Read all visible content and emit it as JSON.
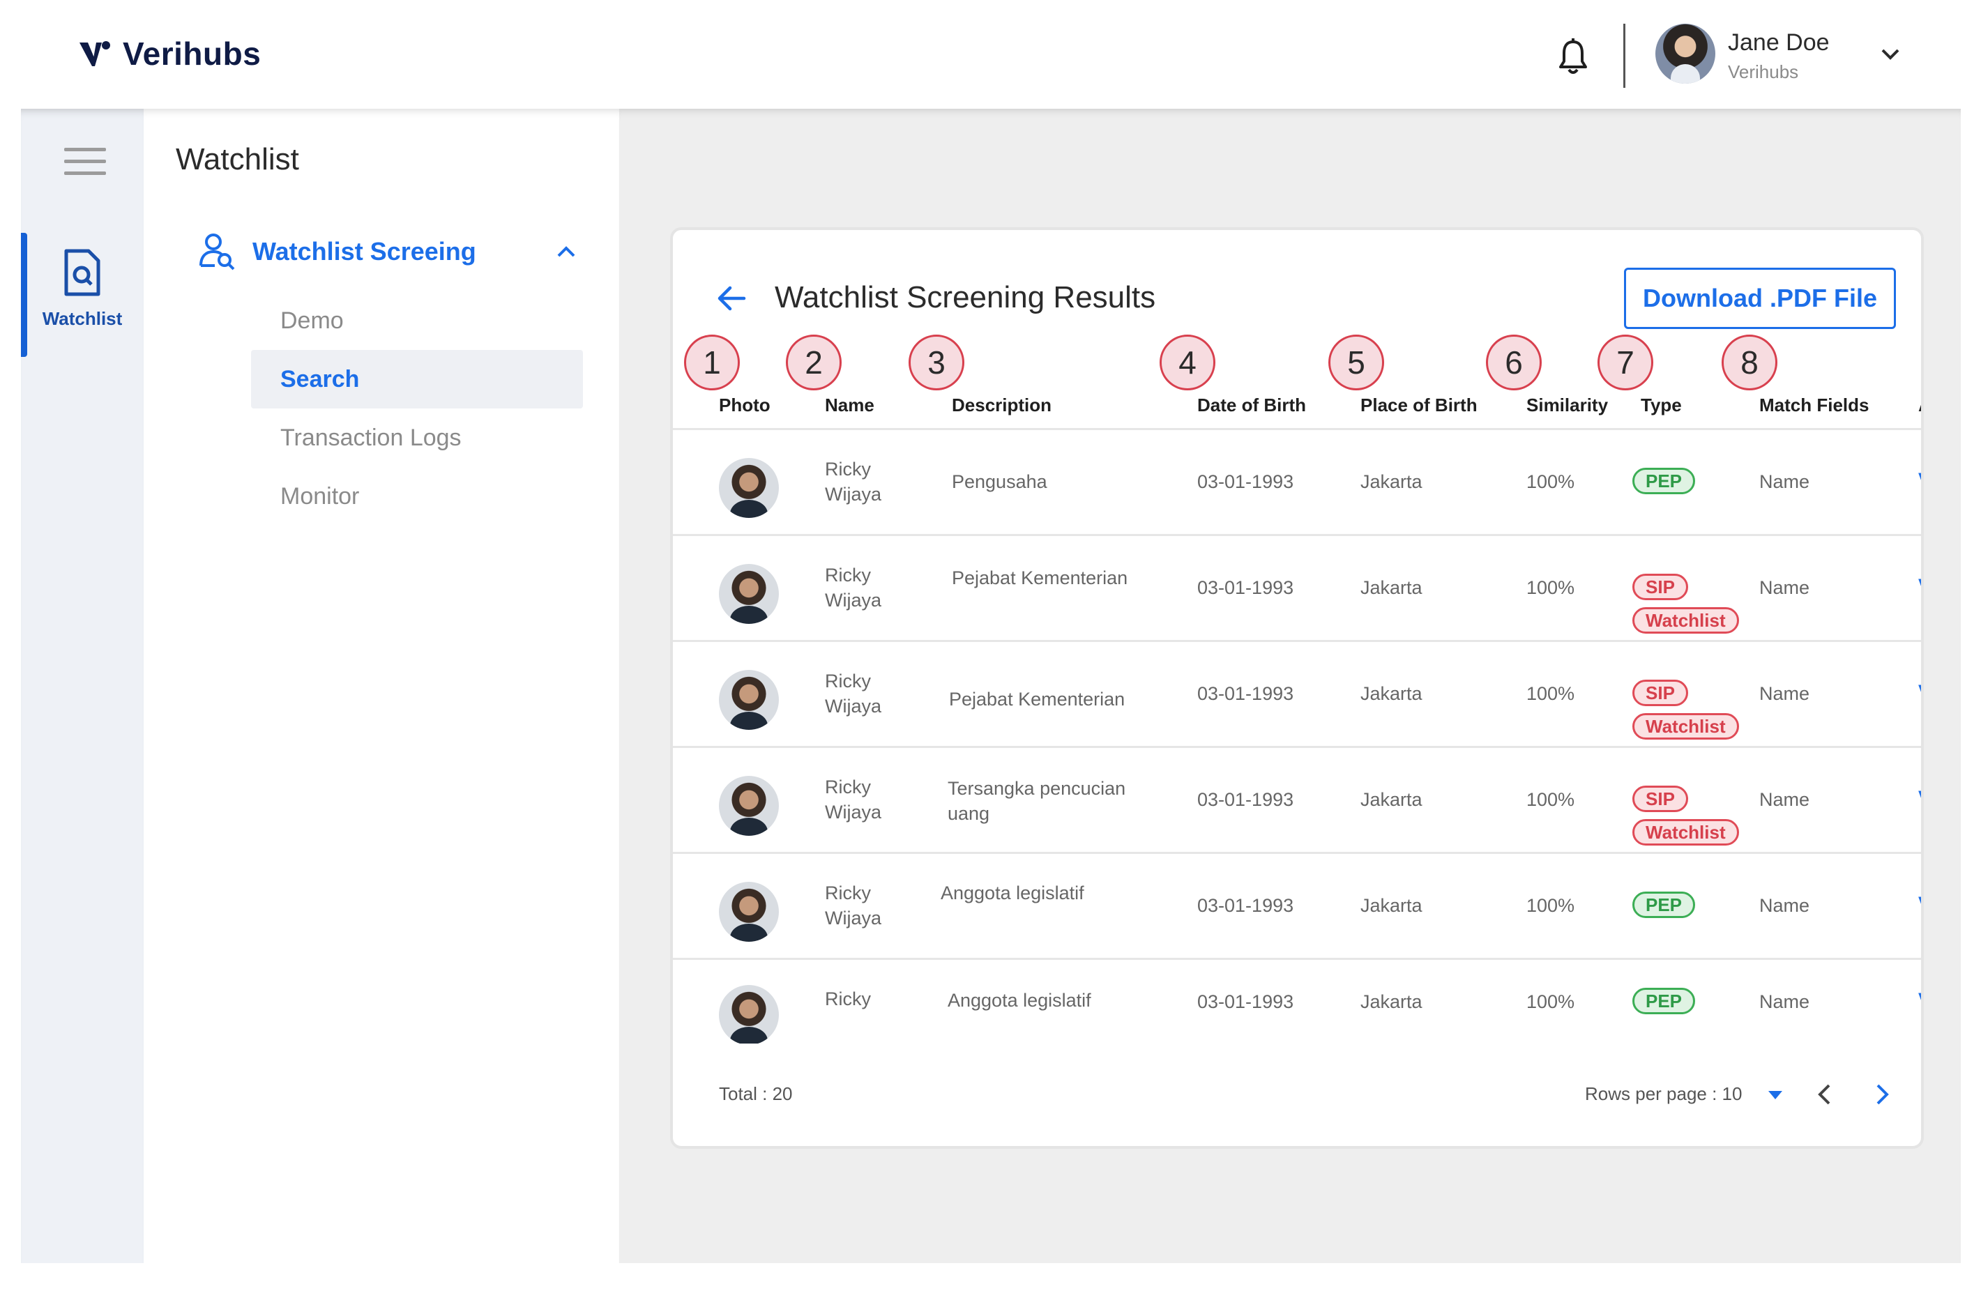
{
  "header": {
    "brand": "Verihubs",
    "user_name": "Jane Doe",
    "user_org": "Verihubs"
  },
  "rail": {
    "active_label": "Watchlist"
  },
  "sidebar": {
    "title": "Watchlist",
    "group_label": "Watchlist Screeing",
    "items": [
      {
        "label": "Demo"
      },
      {
        "label": "Search"
      },
      {
        "label": "Transaction Logs"
      },
      {
        "label": "Monitor"
      }
    ],
    "active_index": 1
  },
  "results": {
    "title": "Watchlist Screening Results",
    "download_label": "Download .PDF File",
    "markers": [
      "1",
      "2",
      "3",
      "4",
      "5",
      "6",
      "7",
      "8"
    ],
    "columns": [
      "Photo",
      "Name",
      "Description",
      "Date of Birth",
      "Place of Birth",
      "Similarity",
      "Type",
      "Match Fields",
      "Ac"
    ],
    "rows": [
      {
        "name_first": "Ricky",
        "name_last": "Wijaya",
        "description": "Pengusaha",
        "description_2": "",
        "dob": "03-01-1993",
        "pob": "Jakarta",
        "similarity": "100%",
        "types": [
          "PEP"
        ],
        "match_fields": "Name",
        "action": "Vi"
      },
      {
        "name_first": "Ricky",
        "name_last": "Wijaya",
        "description": "Pejabat Kementerian",
        "description_2": "",
        "dob": "03-01-1993",
        "pob": "Jakarta",
        "similarity": "100%",
        "types": [
          "SIP",
          "Watchlist"
        ],
        "match_fields": "Name",
        "action": "Vi"
      },
      {
        "name_first": "Ricky",
        "name_last": "Wijaya",
        "description": "Pejabat Kementerian",
        "description_2": "",
        "dob": "03-01-1993",
        "pob": "Jakarta",
        "similarity": "100%",
        "types": [
          "SIP",
          "Watchlist"
        ],
        "match_fields": "Name",
        "action": "Vi"
      },
      {
        "name_first": "Ricky",
        "name_last": "Wijaya",
        "description": "Tersangka pencucian",
        "description_2": "uang",
        "dob": "03-01-1993",
        "pob": "Jakarta",
        "similarity": "100%",
        "types": [
          "SIP",
          "Watchlist"
        ],
        "match_fields": "Name",
        "action": "Vi"
      },
      {
        "name_first": "Ricky",
        "name_last": "Wijaya",
        "description": "Anggota legislatif",
        "description_2": "",
        "dob": "03-01-1993",
        "pob": "Jakarta",
        "similarity": "100%",
        "types": [
          "PEP"
        ],
        "match_fields": "Name",
        "action": "Vi"
      },
      {
        "name_first": "Ricky",
        "name_last": "",
        "description": "Anggota legislatif",
        "description_2": "",
        "dob": "03-01-1993",
        "pob": "Jakarta",
        "similarity": "100%",
        "types": [
          "PEP"
        ],
        "match_fields": "Name",
        "action": "Vi"
      }
    ],
    "total_label": "Total : 20",
    "rows_per_page_label": "Rows per page : 10"
  },
  "colors": {
    "accent": "#1c6ee8",
    "pep_green": "#3cae55",
    "sip_red": "#e04b57"
  }
}
